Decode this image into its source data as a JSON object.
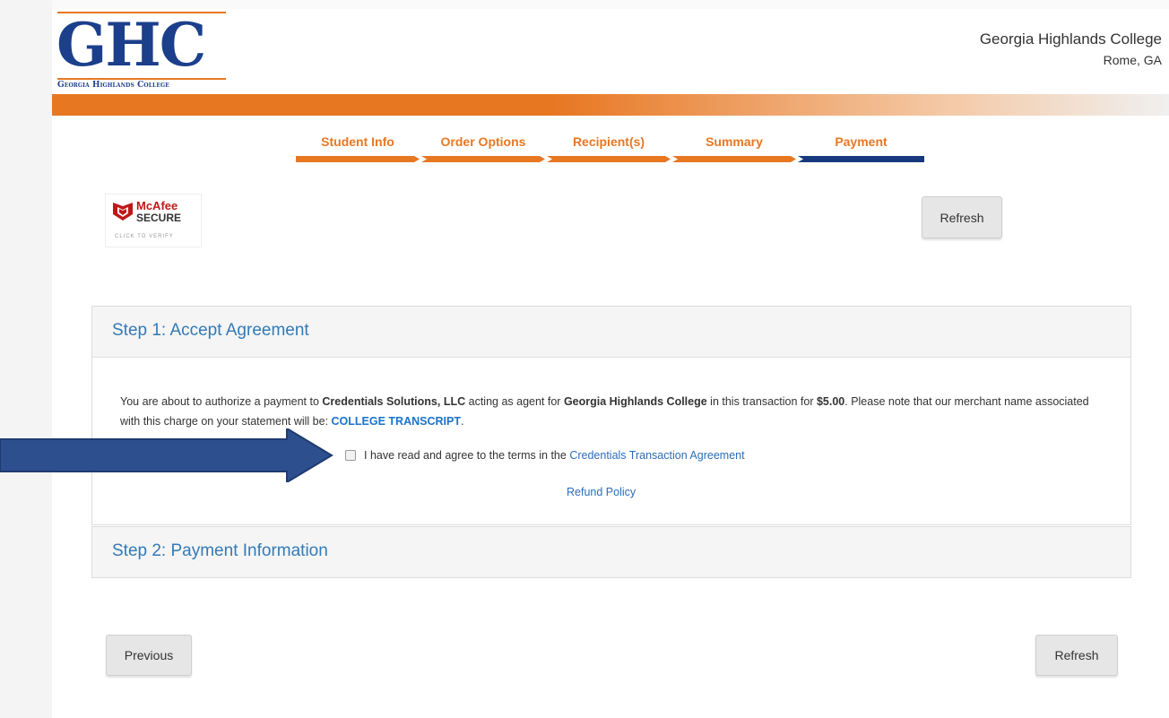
{
  "header": {
    "logo": {
      "letters": "GHC",
      "subtitle": "Georgia Highlands College"
    },
    "college_name": "Georgia Highlands College",
    "college_city": "Rome, GA"
  },
  "steps": [
    {
      "label": "Student Info",
      "state": "done"
    },
    {
      "label": "Order Options",
      "state": "done"
    },
    {
      "label": "Recipient(s)",
      "state": "done"
    },
    {
      "label": "Summary",
      "state": "done"
    },
    {
      "label": "Payment",
      "state": "active"
    }
  ],
  "colors": {
    "accent": "#e87722",
    "brand_blue": "#1b3f8b",
    "active_step": "#163a7d",
    "link": "#2a6ebb"
  },
  "badge": {
    "brand": "McAfee",
    "secure": "SECURE",
    "verify": "CLICK TO VERIFY",
    "icon": "mcafee-shield-icon"
  },
  "buttons": {
    "refresh": "Refresh",
    "previous": "Previous"
  },
  "step1": {
    "title": "Step 1: Accept Agreement",
    "text_before_company": "You are about to authorize a payment to ",
    "company": "Credentials Solutions, LLC",
    "text_agent": " acting as agent for ",
    "college": "Georgia Highlands College",
    "text_transaction": " in this transaction for ",
    "amount": "$5.00",
    "text_note": ". Please note that our merchant name associated with this charge on your statement will be: ",
    "merchant_name": "COLLEGE TRANSCRIPT",
    "text_end": ".",
    "agree_text": "I have read and agree to the terms in the ",
    "agreement_link": "Credentials Transaction Agreement",
    "refund_link": "Refund Policy",
    "checkbox_checked": false
  },
  "step2": {
    "title": "Step 2: Payment Information"
  },
  "annotation": {
    "icon": "right-arrow-icon"
  }
}
